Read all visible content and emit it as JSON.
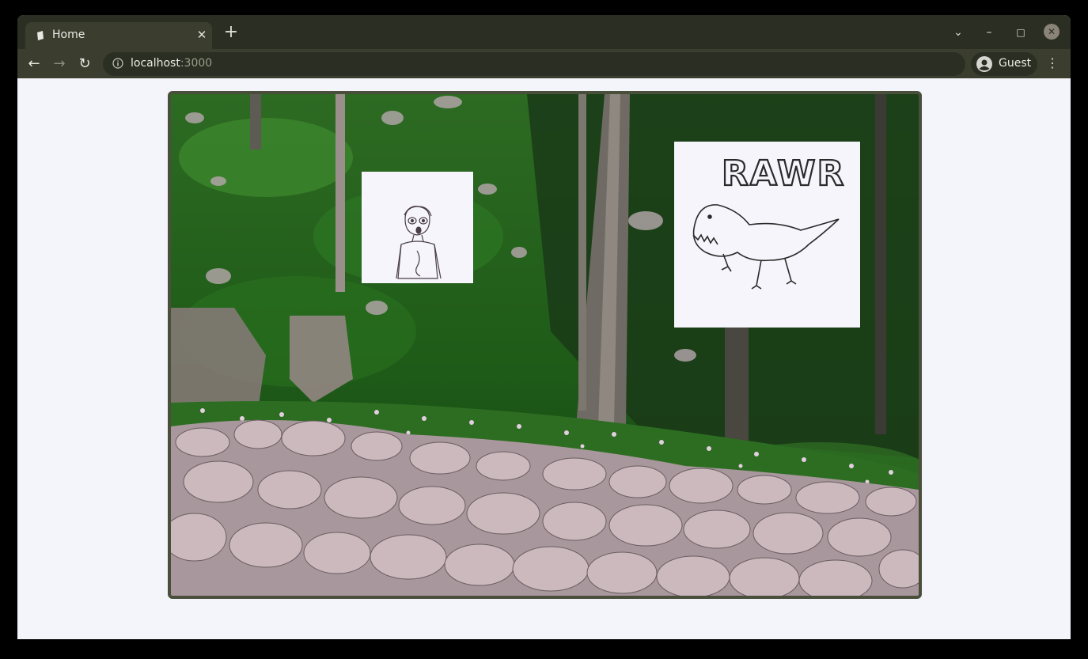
{
  "browser": {
    "tab_title": "Home",
    "tab_close_label": "✕",
    "new_tab_label": "+",
    "url_host": "localhost",
    "url_port": ":3000",
    "profile_name": "Guest",
    "menu_label": "⋮",
    "back_label": "←",
    "forward_label": "→",
    "reload_label": "↻",
    "tab_search_label": "⌄",
    "minimize_label": "–",
    "maximize_label": "□",
    "close_label": "✕"
  },
  "page": {
    "rawr_text": "RAWR"
  },
  "colors": {
    "frame": "#2b2e22",
    "toolbar": "#3b3e2f",
    "page_bg": "#f4f5fb",
    "scene_border": "#4a4f3c"
  }
}
